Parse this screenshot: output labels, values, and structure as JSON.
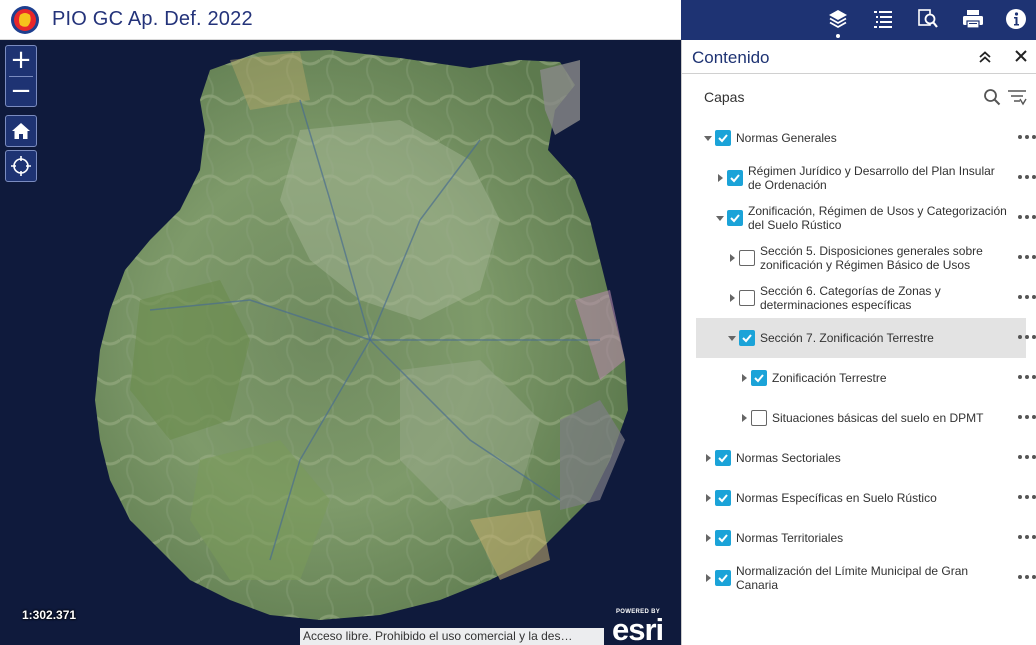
{
  "app": {
    "title": "PIO GC Ap. Def. 2022"
  },
  "header_tools": [
    {
      "name": "layers-icon",
      "active": true
    },
    {
      "name": "legend-icon",
      "active": false
    },
    {
      "name": "query-icon",
      "active": false
    },
    {
      "name": "print-icon",
      "active": false
    },
    {
      "name": "info-icon",
      "active": false
    }
  ],
  "map": {
    "zoom_in_label": "+",
    "zoom_out_label": "−",
    "scale": "1:302.371",
    "attribution": "Acceso libre. Prohibido el uso comercial y la des…",
    "esri_powered": "POWERED BY",
    "esri_word": "esri"
  },
  "panel": {
    "title": "Contenido",
    "section_label": "Capas",
    "layers": [
      {
        "label": "Normas Generales",
        "checked": true,
        "expanded": true,
        "level": 0,
        "selected": false
      },
      {
        "label": "Régimen Jurídico y Desarrollo del Plan Insular de Ordenación",
        "checked": true,
        "expanded": false,
        "level": 1,
        "selected": false
      },
      {
        "label": "Zonificación, Régimen de Usos y Categorización del Suelo Rústico",
        "checked": true,
        "expanded": true,
        "level": 1,
        "selected": false
      },
      {
        "label": "Sección 5. Disposiciones generales sobre zonificación y Régimen Básico de Usos",
        "checked": false,
        "expanded": false,
        "level": 2,
        "selected": false
      },
      {
        "label": "Sección 6. Categorías de Zonas y determinaciones específicas",
        "checked": false,
        "expanded": false,
        "level": 2,
        "selected": false
      },
      {
        "label": "Sección 7. Zonificación Terrestre",
        "checked": true,
        "expanded": true,
        "level": 2,
        "selected": true
      },
      {
        "label": "Zonificación Terrestre",
        "checked": true,
        "expanded": false,
        "level": 3,
        "selected": false
      },
      {
        "label": "Situaciones básicas del suelo en DPMT",
        "checked": false,
        "expanded": false,
        "level": 3,
        "selected": false
      },
      {
        "label": "Normas Sectoriales",
        "checked": true,
        "expanded": false,
        "level": 0,
        "selected": false
      },
      {
        "label": "Normas Específicas en Suelo Rústico",
        "checked": true,
        "expanded": false,
        "level": 0,
        "selected": false
      },
      {
        "label": "Normas Territoriales",
        "checked": true,
        "expanded": false,
        "level": 0,
        "selected": false
      },
      {
        "label": "Normalización del Límite Municipal de Gran Canaria",
        "checked": true,
        "expanded": false,
        "level": 0,
        "selected": false
      }
    ]
  },
  "colors": {
    "header_bg": "#1e3373",
    "accent": "#1ba3d8",
    "title_text": "#24337a",
    "selected_row": "#e3e3e3"
  }
}
